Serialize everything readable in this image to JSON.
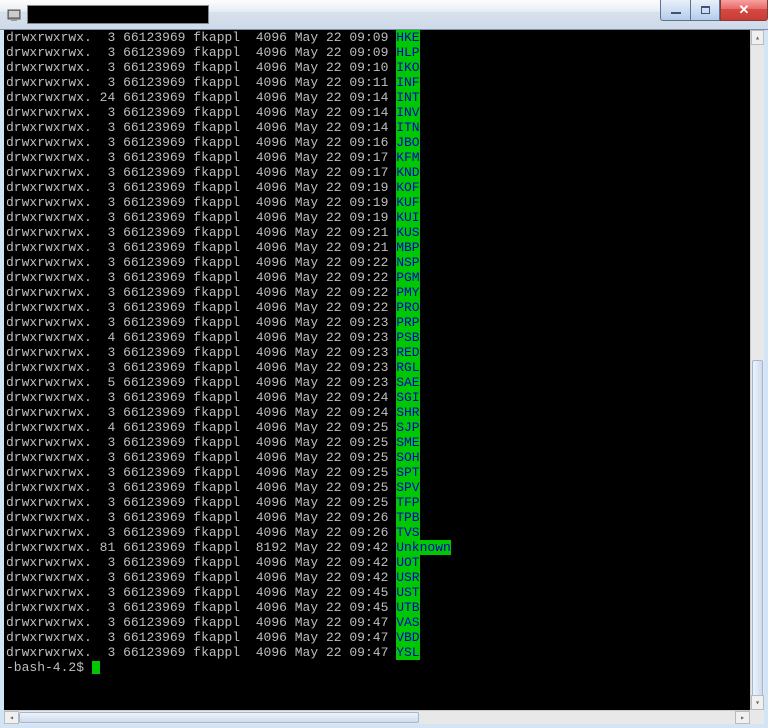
{
  "title_input_value": "",
  "prompt": "-bash-4.2$ ",
  "columns": {
    "perm": "drwxrwxrwx.",
    "owner": "66123969",
    "group": "fkappl"
  },
  "rows": [
    {
      "links": 3,
      "size": 4096,
      "date": "May 22 09:09",
      "name": "HKE"
    },
    {
      "links": 3,
      "size": 4096,
      "date": "May 22 09:09",
      "name": "HLP"
    },
    {
      "links": 3,
      "size": 4096,
      "date": "May 22 09:10",
      "name": "IKO"
    },
    {
      "links": 3,
      "size": 4096,
      "date": "May 22 09:11",
      "name": "INF"
    },
    {
      "links": 24,
      "size": 4096,
      "date": "May 22 09:14",
      "name": "INT"
    },
    {
      "links": 3,
      "size": 4096,
      "date": "May 22 09:14",
      "name": "INV"
    },
    {
      "links": 3,
      "size": 4096,
      "date": "May 22 09:14",
      "name": "ITN"
    },
    {
      "links": 3,
      "size": 4096,
      "date": "May 22 09:16",
      "name": "JBO"
    },
    {
      "links": 3,
      "size": 4096,
      "date": "May 22 09:17",
      "name": "KFM"
    },
    {
      "links": 3,
      "size": 4096,
      "date": "May 22 09:17",
      "name": "KND"
    },
    {
      "links": 3,
      "size": 4096,
      "date": "May 22 09:19",
      "name": "KOF"
    },
    {
      "links": 3,
      "size": 4096,
      "date": "May 22 09:19",
      "name": "KUF"
    },
    {
      "links": 3,
      "size": 4096,
      "date": "May 22 09:19",
      "name": "KUI"
    },
    {
      "links": 3,
      "size": 4096,
      "date": "May 22 09:21",
      "name": "KUS"
    },
    {
      "links": 3,
      "size": 4096,
      "date": "May 22 09:21",
      "name": "MBP"
    },
    {
      "links": 3,
      "size": 4096,
      "date": "May 22 09:22",
      "name": "NSP"
    },
    {
      "links": 3,
      "size": 4096,
      "date": "May 22 09:22",
      "name": "PGM"
    },
    {
      "links": 3,
      "size": 4096,
      "date": "May 22 09:22",
      "name": "PMY"
    },
    {
      "links": 3,
      "size": 4096,
      "date": "May 22 09:22",
      "name": "PRO"
    },
    {
      "links": 3,
      "size": 4096,
      "date": "May 22 09:23",
      "name": "PRP"
    },
    {
      "links": 4,
      "size": 4096,
      "date": "May 22 09:23",
      "name": "PSB"
    },
    {
      "links": 3,
      "size": 4096,
      "date": "May 22 09:23",
      "name": "RED"
    },
    {
      "links": 3,
      "size": 4096,
      "date": "May 22 09:23",
      "name": "RGL"
    },
    {
      "links": 5,
      "size": 4096,
      "date": "May 22 09:23",
      "name": "SAE"
    },
    {
      "links": 3,
      "size": 4096,
      "date": "May 22 09:24",
      "name": "SGI"
    },
    {
      "links": 3,
      "size": 4096,
      "date": "May 22 09:24",
      "name": "SHR"
    },
    {
      "links": 4,
      "size": 4096,
      "date": "May 22 09:25",
      "name": "SJP"
    },
    {
      "links": 3,
      "size": 4096,
      "date": "May 22 09:25",
      "name": "SME"
    },
    {
      "links": 3,
      "size": 4096,
      "date": "May 22 09:25",
      "name": "SOH"
    },
    {
      "links": 3,
      "size": 4096,
      "date": "May 22 09:25",
      "name": "SPT"
    },
    {
      "links": 3,
      "size": 4096,
      "date": "May 22 09:25",
      "name": "SPV"
    },
    {
      "links": 3,
      "size": 4096,
      "date": "May 22 09:25",
      "name": "TFP"
    },
    {
      "links": 3,
      "size": 4096,
      "date": "May 22 09:26",
      "name": "TPB"
    },
    {
      "links": 3,
      "size": 4096,
      "date": "May 22 09:26",
      "name": "TVS"
    },
    {
      "links": 81,
      "size": 8192,
      "date": "May 22 09:42",
      "name": "Unknown"
    },
    {
      "links": 3,
      "size": 4096,
      "date": "May 22 09:42",
      "name": "UOT"
    },
    {
      "links": 3,
      "size": 4096,
      "date": "May 22 09:42",
      "name": "USR"
    },
    {
      "links": 3,
      "size": 4096,
      "date": "May 22 09:45",
      "name": "UST"
    },
    {
      "links": 3,
      "size": 4096,
      "date": "May 22 09:45",
      "name": "UTB"
    },
    {
      "links": 3,
      "size": 4096,
      "date": "May 22 09:47",
      "name": "VAS"
    },
    {
      "links": 3,
      "size": 4096,
      "date": "May 22 09:47",
      "name": "VBD"
    },
    {
      "links": 3,
      "size": 4096,
      "date": "May 22 09:47",
      "name": "YSL"
    }
  ]
}
